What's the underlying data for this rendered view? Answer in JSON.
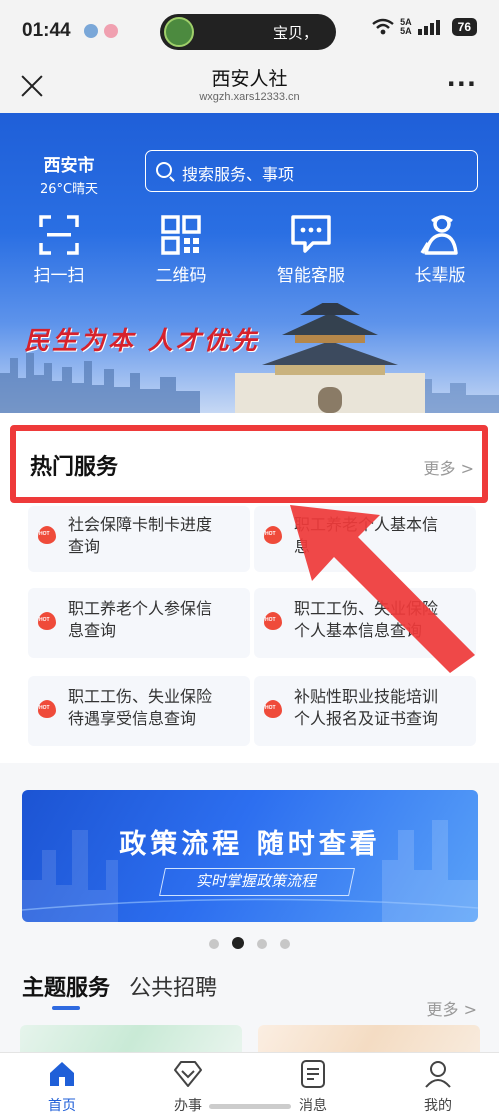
{
  "status_bar": {
    "time": "01:44",
    "pill_text": "宝贝，",
    "network_top": "5A",
    "network_bottom": "5A",
    "battery": "76"
  },
  "title_bar": {
    "title": "西安人社",
    "url": "wxgzh.xars12333.cn",
    "more_label": "···"
  },
  "hero": {
    "city": "西安市",
    "weather": "26°C晴天",
    "search_placeholder": "搜索服务、事项",
    "quick_actions": [
      {
        "label": "扫一扫",
        "icon": "scan-icon"
      },
      {
        "label": "二维码",
        "icon": "qrcode-icon"
      },
      {
        "label": "智能客服",
        "icon": "chat-bubble-icon"
      },
      {
        "label": "长辈版",
        "icon": "elder-person-icon"
      }
    ],
    "slogan": "民生为本 人才优先"
  },
  "hot_services": {
    "title": "热门服务",
    "more": "更多 >",
    "items": [
      {
        "line1": "社会保障卡制卡进度",
        "line2": "查询"
      },
      {
        "line1": "职工养老个人基本信",
        "line2": "息"
      },
      {
        "line1": "职工养老个人参保信",
        "line2": "息查询"
      },
      {
        "line1": "职工工伤、失业保险",
        "line2": "个人基本信息查询"
      },
      {
        "line1": "职工工伤、失业保险",
        "line2": "待遇享受信息查询"
      },
      {
        "line1": "补贴性职业技能培训",
        "line2": "个人报名及证书查询"
      }
    ],
    "highlight_color": "#ee3a3a"
  },
  "banner": {
    "title": "政策流程 随时查看",
    "subtitle": "实时掌握政策流程",
    "active_dot_index": 1,
    "dot_count": 4
  },
  "theme_section": {
    "tabs": [
      "主题服务",
      "公共招聘"
    ],
    "more": "更多 >"
  },
  "bottom_nav": [
    {
      "label": "首页",
      "icon": "home-icon",
      "active": true
    },
    {
      "label": "办事",
      "icon": "diamond-icon",
      "active": false
    },
    {
      "label": "消息",
      "icon": "message-doc-icon",
      "active": false
    },
    {
      "label": "我的",
      "icon": "person-icon",
      "active": false
    }
  ],
  "colors": {
    "brand_blue": "#1f5fd8",
    "hot_red": "#ef4b3a"
  }
}
